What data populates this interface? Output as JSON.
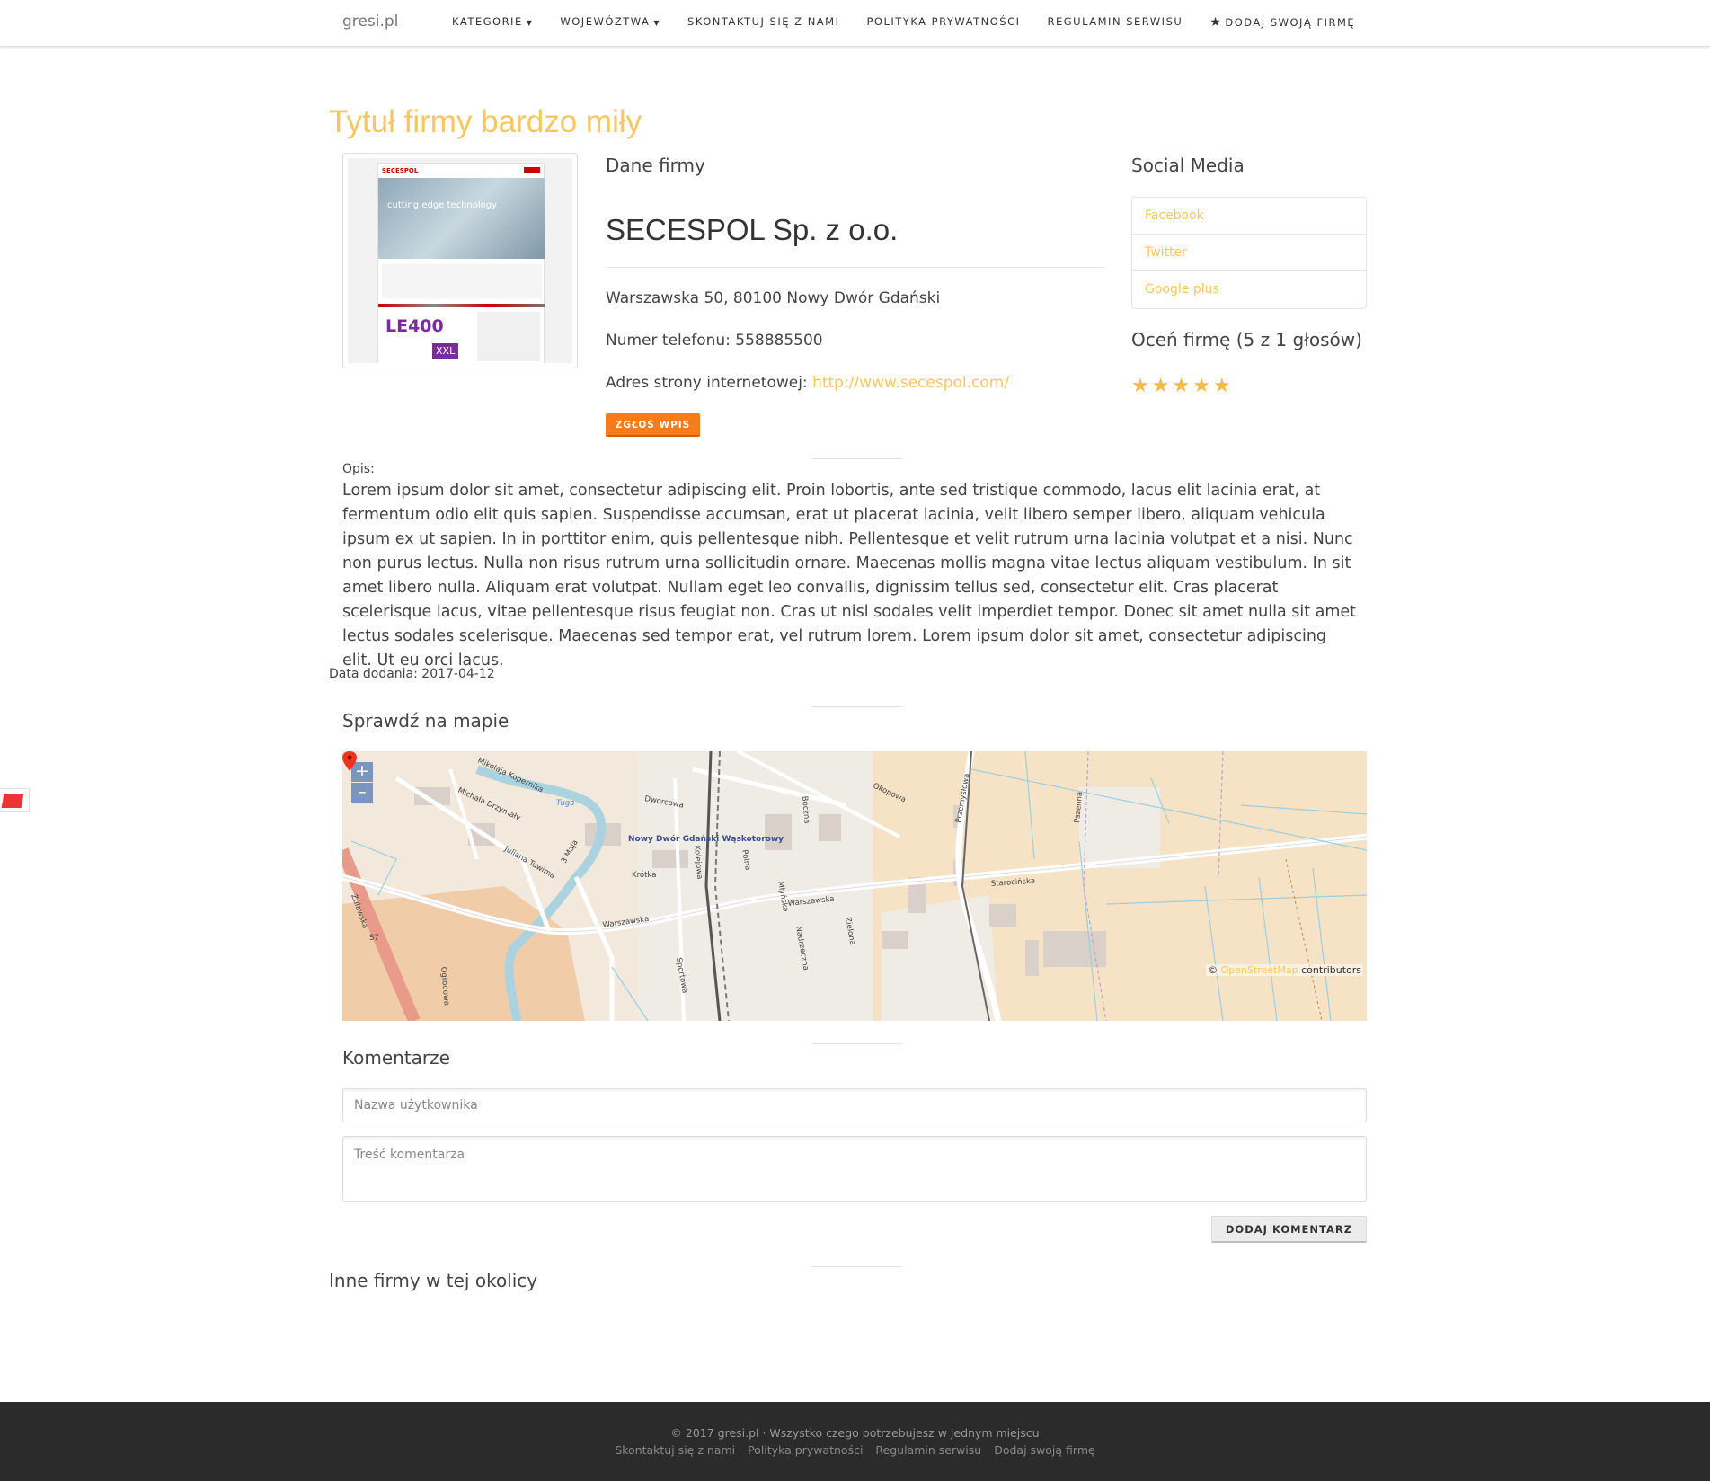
{
  "navbar": {
    "brand": "gresi.pl",
    "items": [
      {
        "label": "KATEGORIE",
        "dropdown": true
      },
      {
        "label": "WOJEWÓZTWA",
        "dropdown": true
      },
      {
        "label": "SKONTAKTUJ SIĘ Z NAMI"
      },
      {
        "label": "POLITYKA PRYWATNOŚCI"
      },
      {
        "label": "REGULAMIN SERWISU"
      },
      {
        "label": "DODAJ SWOJĄ FIRMĘ",
        "icon": "star-icon"
      }
    ]
  },
  "page_title": "Tytuł firmy bardzo miły",
  "thumbnail": {
    "logo_text": "SECESPOL",
    "hero_text": "cutting edge technology",
    "product_text": "LE400",
    "xxl_text": "XXL"
  },
  "company": {
    "section_title": "Dane firmy",
    "name": "SECESPOL Sp. z o.o.",
    "address": "Warszawska 50, 80100 Nowy Dwór Gdański",
    "phone_label": "Numer telefonu:",
    "phone": "558885500",
    "website_label": "Adres strony internetowej:",
    "website": "http://www.secespol.com/",
    "report_button": "ZGŁOŚ WPIS"
  },
  "social": {
    "title": "Social Media",
    "items": [
      "Facebook",
      "Twitter",
      "Google plus"
    ]
  },
  "rating": {
    "title": "Oceń firmę (5 z 1 głosów)",
    "stars": 5,
    "star_color": "#f5b94a"
  },
  "description": {
    "label": "Opis:",
    "text": "Lorem ipsum dolor sit amet, consectetur adipiscing elit. Proin lobortis, ante sed tristique commodo, lacus elit lacinia erat, at fermentum odio elit quis sapien. Suspendisse accumsan, erat ut placerat lacinia, velit libero semper libero, aliquam vehicula ipsum ex ut sapien. In in porttitor enim, quis pellentesque nibh. Pellentesque et velit rutrum urna lacinia volutpat et a nisi. Nunc non purus lectus. Nulla non risus rutrum urna sollicitudin ornare. Maecenas mollis magna vitae lectus aliquam vestibulum. In sit amet libero nulla. Aliquam erat volutpat. Nullam eget leo convallis, dignissim tellus sed, consectetur elit. Cras placerat scelerisque lacus, vitae pellentesque risus feugiat non. Cras ut nisl sodales velit imperdiet tempor. Donec sit amet nulla sit amet lectus sodales scelerisque. Maecenas sed tempor erat, vel rutrum lorem. Lorem ipsum dolor sit amet, consectetur adipiscing elit. Ut eu orci lacus."
  },
  "date_added": "Data dodania: 2017-04-12",
  "map": {
    "title": "Sprawdź na mapie",
    "zoom_in": "+",
    "zoom_out": "–",
    "attribution_prefix": "©",
    "attribution_link": "OpenStreetMap",
    "attribution_suffix": "contributors",
    "labels": {
      "station": "Nowy Dwór Gdański Wąskotorowy",
      "warszawska": "Warszawska",
      "starocinska": "Starocińska",
      "okopowa": "Okopowa",
      "przemyslowa": "Przemysłowa",
      "krotka": "Krótka",
      "dworcowa": "Dworcowa",
      "zulawska": "Żuławska",
      "tuga": "Tuga",
      "s7": "S7",
      "polna": "Polna",
      "mlyńska": "Młyńska",
      "zielona": "Zielona",
      "nadrzeczna": "Nadrzeczna",
      "sportowa": "Sportowa",
      "ogrodowa": "Ogrodowa",
      "kolejowa": "Kolejowa",
      "bocna": "Boczna",
      "pszenna": "Pszenna",
      "mickiewicza": "Michała Drzymały",
      "kopernika": "Mikołaja Kopernika",
      "tuwima": "Juliana Tuwima",
      "maja": "3 Maja"
    }
  },
  "comments": {
    "title": "Komentarze",
    "username_placeholder": "Nazwa użytkownika",
    "content_placeholder": "Treść komentarza",
    "submit": "DODAJ KOMENTARZ"
  },
  "nearby": {
    "title": "Inne firmy w tej okolicy"
  },
  "footer": {
    "copyright": "© 2017 gresi.pl · Wszystko czego potrzebujesz w jednym miejscu",
    "links": [
      "Skontaktuj się z nami",
      "Polityka prywatności",
      "Regulamin serwisu",
      "Dodaj swoją firmę"
    ]
  },
  "colors": {
    "accent": "#f8c660",
    "report": "#f87b1c",
    "footer_bg": "#2b2b2b"
  }
}
